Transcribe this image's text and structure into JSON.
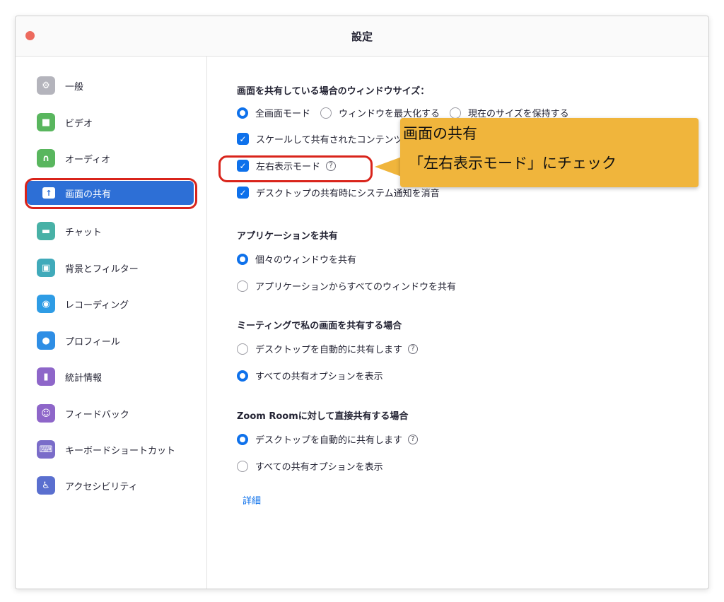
{
  "window": {
    "title": "設定"
  },
  "sidebar": {
    "items": [
      {
        "label": "一般",
        "icon": "gear-icon",
        "color": "#b4b4bc"
      },
      {
        "label": "ビデオ",
        "icon": "video-camera-icon",
        "color": "#59b65e"
      },
      {
        "label": "オーディオ",
        "icon": "headphones-icon",
        "color": "#59b65e"
      },
      {
        "label": "画面の共有",
        "icon": "share-screen-icon",
        "color": "#2d6fd6"
      },
      {
        "label": "チャット",
        "icon": "chat-bubble-icon",
        "color": "#48b1a6"
      },
      {
        "label": "背景とフィルター",
        "icon": "background-person-icon",
        "color": "#40aaba"
      },
      {
        "label": "レコーディング",
        "icon": "record-icon",
        "color": "#2e9ce5"
      },
      {
        "label": "プロフィール",
        "icon": "profile-icon",
        "color": "#2e8ee5"
      },
      {
        "label": "統計情報",
        "icon": "stats-bar-icon",
        "color": "#8e66c9"
      },
      {
        "label": "フィードバック",
        "icon": "smile-icon",
        "color": "#8e66c9"
      },
      {
        "label": "キーボードショートカット",
        "icon": "keyboard-icon",
        "color": "#7a6cc9"
      },
      {
        "label": "アクセシビリティ",
        "icon": "accessibility-icon",
        "color": "#5a6fcf"
      }
    ]
  },
  "window_size": {
    "title": "画面を共有している場合のウィンドウサイズ：",
    "options": [
      "全画面モード",
      "ウィンドウを最大化する",
      "現在のサイズを保持する"
    ],
    "selected": "全画面モード"
  },
  "checkboxes": {
    "scale": "スケールして共有されたコンテンツ",
    "side_by_side": "左右表示モード",
    "silence": "デスクトップの共有時にシステム通知を消音"
  },
  "app_share": {
    "title": "アプリケーションを共有",
    "options": [
      "個々のウィンドウを共有",
      "アプリケーションからすべてのウィンドウを共有"
    ],
    "selected": "個々のウィンドウを共有"
  },
  "meeting_share": {
    "title": "ミーティングで私の画面を共有する場合",
    "options": [
      "デスクトップを自動的に共有します",
      "すべての共有オプションを表示"
    ],
    "selected": "すべての共有オプションを表示"
  },
  "zoom_room_share": {
    "title": "Zoom Roomに対して直接共有する場合",
    "options": [
      "デスクトップを自動的に共有します",
      "すべての共有オプションを表示"
    ],
    "selected": "デスクトップを自動的に共有します"
  },
  "advanced_link": "詳細",
  "help_glyph": "?",
  "callout": {
    "line1": "画面の共有",
    "line2": "「左右表示モード」にチェック"
  },
  "colors": {
    "accent": "#0e71eb",
    "sidebar_active": "#2d6fd6",
    "annotation_red": "#d9241b",
    "callout_bg": "#f0b53c"
  }
}
